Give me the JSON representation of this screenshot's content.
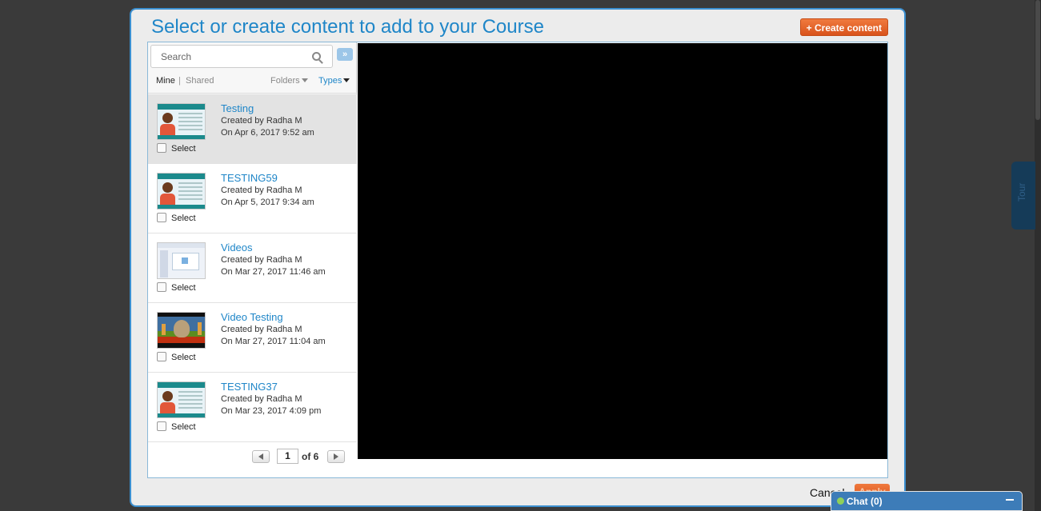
{
  "modal": {
    "title": "Select or create content to add to your Course",
    "create_button": "+ Create content"
  },
  "search": {
    "placeholder": "Search"
  },
  "filters": {
    "mine": "Mine",
    "separator": "|",
    "shared": "Shared",
    "folders": "Folders",
    "types": "Types"
  },
  "items": [
    {
      "title": "Testing",
      "created_by": "Created by Radha M",
      "date": "On Apr 6, 2017 9:52 am",
      "select_label": "Select",
      "thumb": "slide"
    },
    {
      "title": "TESTING59",
      "created_by": "Created by Radha M",
      "date": "On Apr 5, 2017 9:34 am",
      "select_label": "Select",
      "thumb": "slide"
    },
    {
      "title": "Videos",
      "created_by": "Created by Radha M",
      "date": "On Mar 27, 2017 11:46 am",
      "select_label": "Select",
      "thumb": "screen"
    },
    {
      "title": "Video Testing",
      "created_by": "Created by Radha M",
      "date": "On Mar 27, 2017 11:04 am",
      "select_label": "Select",
      "thumb": "cartoon"
    },
    {
      "title": "TESTING37",
      "created_by": "Created by Radha M",
      "date": "On Mar 23, 2017 4:09 pm",
      "select_label": "Select",
      "thumb": "slide"
    }
  ],
  "pager": {
    "current": "1",
    "total_label": "of 6"
  },
  "footer": {
    "cancel": "Cancel",
    "apply": "Apply"
  },
  "tour": {
    "label": "Tour"
  },
  "chat": {
    "label": "Chat  (0)"
  },
  "colors": {
    "accent": "#1f86c8",
    "button": "#e5622a",
    "preview": "#000000"
  }
}
